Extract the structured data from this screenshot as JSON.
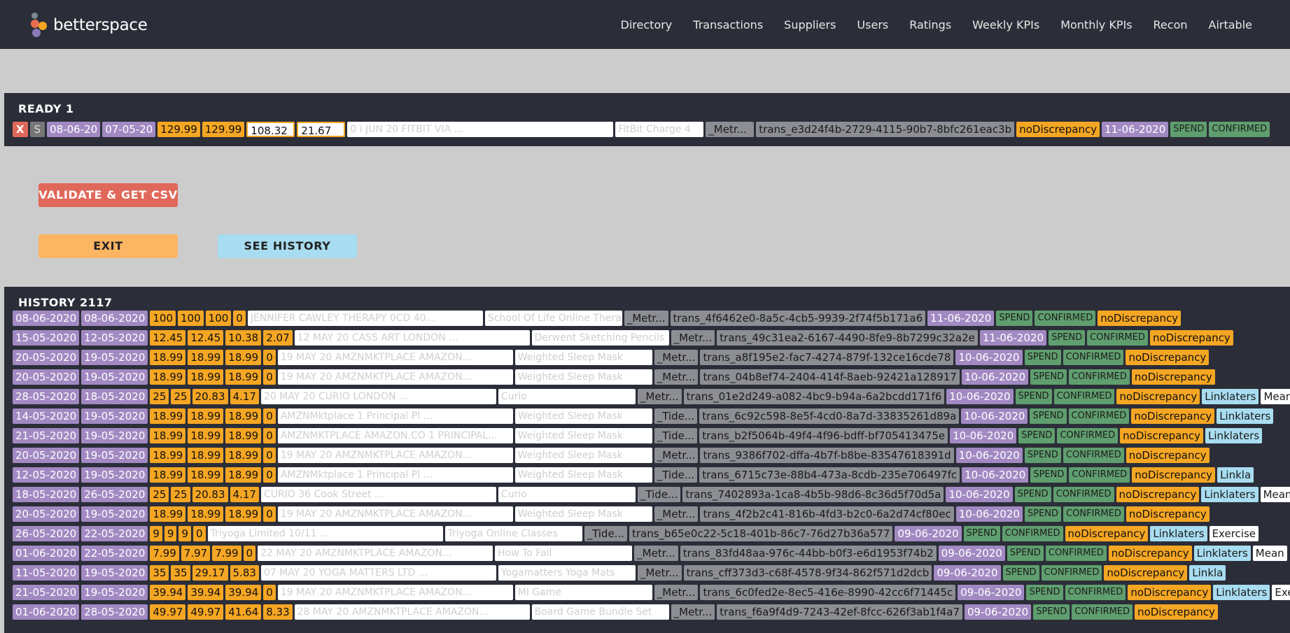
{
  "app": {
    "name": "betterspace"
  },
  "nav": [
    "Directory",
    "Transactions",
    "Suppliers",
    "Users",
    "Ratings",
    "Weekly KPIs",
    "Monthly KPIs",
    "Recon",
    "Airtable"
  ],
  "ready": {
    "title": "READY 1",
    "row": {
      "x_label": "X",
      "s_label": "S",
      "date1": "08-06-20",
      "date2": "07-05-20",
      "amount1": "129.99",
      "amount2": "129.99",
      "input1": "108.32",
      "input2": "21.67",
      "description": "0 i JUN 20 FITBIT VIA ...",
      "merchant": "FitBit Charge 4",
      "tag": "_Metr...",
      "trans_id": "trans_e3d24f4b-2729-4115-90b7-8bfc261eac3b",
      "discrepancy": "noDiscrepancy",
      "date3": "11-06-2020",
      "type": "SPEND",
      "status": "CONFIRMED"
    }
  },
  "buttons": {
    "validate": "VALIDATE & GET CSV",
    "exit": "EXIT",
    "history": "SEE HISTORY"
  },
  "colors": {
    "purple": "#a289c2",
    "orange": "#f5a623",
    "green": "#5f9e6e",
    "lightblue": "#a8dcf0",
    "red": "#e0685a",
    "dark": "#2b2e38"
  },
  "history": {
    "title": "HISTORY 2117",
    "rows": [
      {
        "date1": "08-06-2020",
        "date2": "08-06-2020",
        "nums": [
          "100",
          "100",
          "100",
          "0"
        ],
        "desc": "JENNIFER CAWLEY THERAPY 0CD 40...",
        "merchant": "School Of Life Online Therapy E...",
        "tag": "_Metr...",
        "trans": "trans_4f6462e0-8a5c-4cb5-9939-2f74f5b171a6",
        "date3": "11-06-2020",
        "type": "SPEND",
        "status": "CONFIRMED",
        "disc": "noDiscrepancy",
        "extra1": "",
        "extra2": ""
      },
      {
        "date1": "15-05-2020",
        "date2": "12-05-2020",
        "nums": [
          "12.45",
          "12.45",
          "10.38",
          "2.07"
        ],
        "desc": "12 MAY 20 CASS ART LONDON ...",
        "merchant": "Derwent Sketching Pencils",
        "tag": "_Metr...",
        "trans": "trans_49c31ea2-6167-4490-8fe9-8b7299c32a2e",
        "date3": "11-06-2020",
        "type": "SPEND",
        "status": "CONFIRMED",
        "disc": "noDiscrepancy",
        "extra1": "",
        "extra2": ""
      },
      {
        "date1": "20-05-2020",
        "date2": "19-05-2020",
        "nums": [
          "18.99",
          "18.99",
          "18.99",
          "0"
        ],
        "desc": "19 MAY 20 AMZNMKTPLACE AMAZON...",
        "merchant": "Weighted Sleep Mask",
        "tag": "_Metr...",
        "trans": "trans_a8f195e2-fac7-4274-879f-132ce16cde78",
        "date3": "10-06-2020",
        "type": "SPEND",
        "status": "CONFIRMED",
        "disc": "noDiscrepancy",
        "extra1": "",
        "extra2": ""
      },
      {
        "date1": "20-05-2020",
        "date2": "19-05-2020",
        "nums": [
          "18.99",
          "18.99",
          "18.99",
          "0"
        ],
        "desc": "19 MAY 20 AMZNMKTPLACE AMAZON...",
        "merchant": "Weighted Sleep Mask",
        "tag": "_Metr...",
        "trans": "trans_04b8ef74-2404-414f-8aeb-92421a128917",
        "date3": "10-06-2020",
        "type": "SPEND",
        "status": "CONFIRMED",
        "disc": "noDiscrepancy",
        "extra1": "",
        "extra2": ""
      },
      {
        "date1": "28-05-2020",
        "date2": "18-05-2020",
        "nums": [
          "25",
          "25",
          "20.83",
          "4.17"
        ],
        "desc": "20 MAY 20 CURIO LONDON ...",
        "merchant": "Curio",
        "tag": "_Metr...",
        "trans": "trans_01e2d249-a082-4bc9-b94a-6a2bcdd171f6",
        "date3": "10-06-2020",
        "type": "SPEND",
        "status": "CONFIRMED",
        "disc": "noDiscrepancy",
        "extra1": "Linklaters",
        "extra2": "Meaningful"
      },
      {
        "date1": "14-05-2020",
        "date2": "19-05-2020",
        "nums": [
          "18.99",
          "18.99",
          "18.99",
          "0"
        ],
        "desc": "AMZNMktplace 1 Principal Pl ...",
        "merchant": "Weighted Sleep Mask",
        "tag": "_Tide...",
        "trans": "trans_6c92c598-8e5f-4cd0-8a7d-33835261d89a",
        "date3": "10-06-2020",
        "type": "SPEND",
        "status": "CONFIRMED",
        "disc": "noDiscrepancy",
        "extra1": "Linklaters",
        "extra2": ""
      },
      {
        "date1": "21-05-2020",
        "date2": "19-05-2020",
        "nums": [
          "18.99",
          "18.99",
          "18.99",
          "0"
        ],
        "desc": "AMZNMKTPLACE AMAZON.CO 1 PRINCIPAL...",
        "merchant": "Weighted Sleep Mask",
        "tag": "_Tide...",
        "trans": "trans_b2f5064b-49f4-4f96-bdff-bf705413475e",
        "date3": "10-06-2020",
        "type": "SPEND",
        "status": "CONFIRMED",
        "disc": "noDiscrepancy",
        "extra1": "Linklaters",
        "extra2": ""
      },
      {
        "date1": "20-05-2020",
        "date2": "19-05-2020",
        "nums": [
          "18.99",
          "18.99",
          "18.99",
          "0"
        ],
        "desc": "19 MAY 20 AMZNMKTPLACE AMAZON...",
        "merchant": "Weighted Sleep Mask",
        "tag": "_Metr...",
        "trans": "trans_9386f702-dffa-4b7f-b8be-83547618391d",
        "date3": "10-06-2020",
        "type": "SPEND",
        "status": "CONFIRMED",
        "disc": "noDiscrepancy",
        "extra1": "",
        "extra2": ""
      },
      {
        "date1": "12-05-2020",
        "date2": "19-05-2020",
        "nums": [
          "18.99",
          "18.99",
          "18.99",
          "0"
        ],
        "desc": "AMZNMktplace 1 Principal Pl ...",
        "merchant": "Weighted Sleep Mask",
        "tag": "_Tide...",
        "trans": "trans_6715c73e-88b4-473a-8cdb-235e706497fc",
        "date3": "10-06-2020",
        "type": "SPEND",
        "status": "CONFIRMED",
        "disc": "noDiscrepancy",
        "extra1": "Linkla",
        "extra2": ""
      },
      {
        "date1": "18-05-2020",
        "date2": "26-05-2020",
        "nums": [
          "25",
          "25",
          "20.83",
          "4.17"
        ],
        "desc": "CURIO 36 Cook Street ...",
        "merchant": "Curio",
        "tag": "_Tide...",
        "trans": "trans_7402893a-1ca8-4b5b-98d6-8c36d5f70d5a",
        "date3": "10-06-2020",
        "type": "SPEND",
        "status": "CONFIRMED",
        "disc": "noDiscrepancy",
        "extra1": "Linklaters",
        "extra2": "MeaningfulActivity"
      },
      {
        "date1": "20-05-2020",
        "date2": "19-05-2020",
        "nums": [
          "18.99",
          "18.99",
          "18.99",
          "0"
        ],
        "desc": "19 MAY 20 AMZNMKTPLACE AMAZON...",
        "merchant": "Weighted Sleep Mask",
        "tag": "_Metr...",
        "trans": "trans_4f2b2c41-816b-4fd3-b2c0-6a2d74cf80ec",
        "date3": "10-06-2020",
        "type": "SPEND",
        "status": "CONFIRMED",
        "disc": "noDiscrepancy",
        "extra1": "",
        "extra2": ""
      },
      {
        "date1": "26-05-2020",
        "date2": "22-05-2020",
        "nums": [
          "9",
          "9",
          "9",
          "0"
        ],
        "desc": "Triyoga Limited 10/11 ...",
        "merchant": "Triyoga Online Classes",
        "tag": "_Tide...",
        "trans": "trans_b65e0c22-5c18-401b-86c7-76d27b36a577",
        "date3": "09-06-2020",
        "type": "SPEND",
        "status": "CONFIRMED",
        "disc": "noDiscrepancy",
        "extra1": "Linklaters",
        "extra2": "Exercise"
      },
      {
        "date1": "01-06-2020",
        "date2": "22-05-2020",
        "nums": [
          "7.99",
          "7.97",
          "7.99",
          "0"
        ],
        "desc": "22 MAY 20 AMZNMKTPLACE AMAZON...",
        "merchant": "How To Fail",
        "tag": "_Metr...",
        "trans": "trans_83fd48aa-976c-44bb-b0f3-e6d1953f74b2",
        "date3": "09-06-2020",
        "type": "SPEND",
        "status": "CONFIRMED",
        "disc": "noDiscrepancy",
        "extra1": "Linklaters",
        "extra2": "Mean"
      },
      {
        "date1": "11-05-2020",
        "date2": "19-05-2020",
        "nums": [
          "35",
          "35",
          "29.17",
          "5.83"
        ],
        "desc": "07 MAY 20 YOGA MATTERS LTD ...",
        "merchant": "Yogamatters Yoga Mats",
        "tag": "_Metr...",
        "trans": "trans_cff373d3-c68f-4578-9f34-862f571d2dcb",
        "date3": "09-06-2020",
        "type": "SPEND",
        "status": "CONFIRMED",
        "disc": "noDiscrepancy",
        "extra1": "Linkla",
        "extra2": ""
      },
      {
        "date1": "21-05-2020",
        "date2": "19-05-2020",
        "nums": [
          "39.94",
          "39.94",
          "39.94",
          "0"
        ],
        "desc": "19 MAY 20 AMZNMKTPLACE AMAZON...",
        "merchant": "Ml Game",
        "tag": "_Metr...",
        "trans": "trans_6c0fed2e-8ec5-416e-8990-42cc6f71445c",
        "date3": "09-06-2020",
        "type": "SPEND",
        "status": "CONFIRMED",
        "disc": "noDiscrepancy",
        "extra1": "Linklaters",
        "extra2": "Exe"
      },
      {
        "date1": "01-06-2020",
        "date2": "28-05-2020",
        "nums": [
          "49.97",
          "49.97",
          "41.64",
          "8.33"
        ],
        "desc": "28 MAY 20 AMZNMKTPLACE AMAZON...",
        "merchant": "Board Game Bundle Set",
        "tag": "_Metr...",
        "trans": "trans_f6a9f4d9-7243-42ef-8fcc-626f3ab1f4a7",
        "date3": "09-06-2020",
        "type": "SPEND",
        "status": "CONFIRMED",
        "disc": "noDiscrepancy",
        "extra1": "",
        "extra2": ""
      }
    ]
  }
}
